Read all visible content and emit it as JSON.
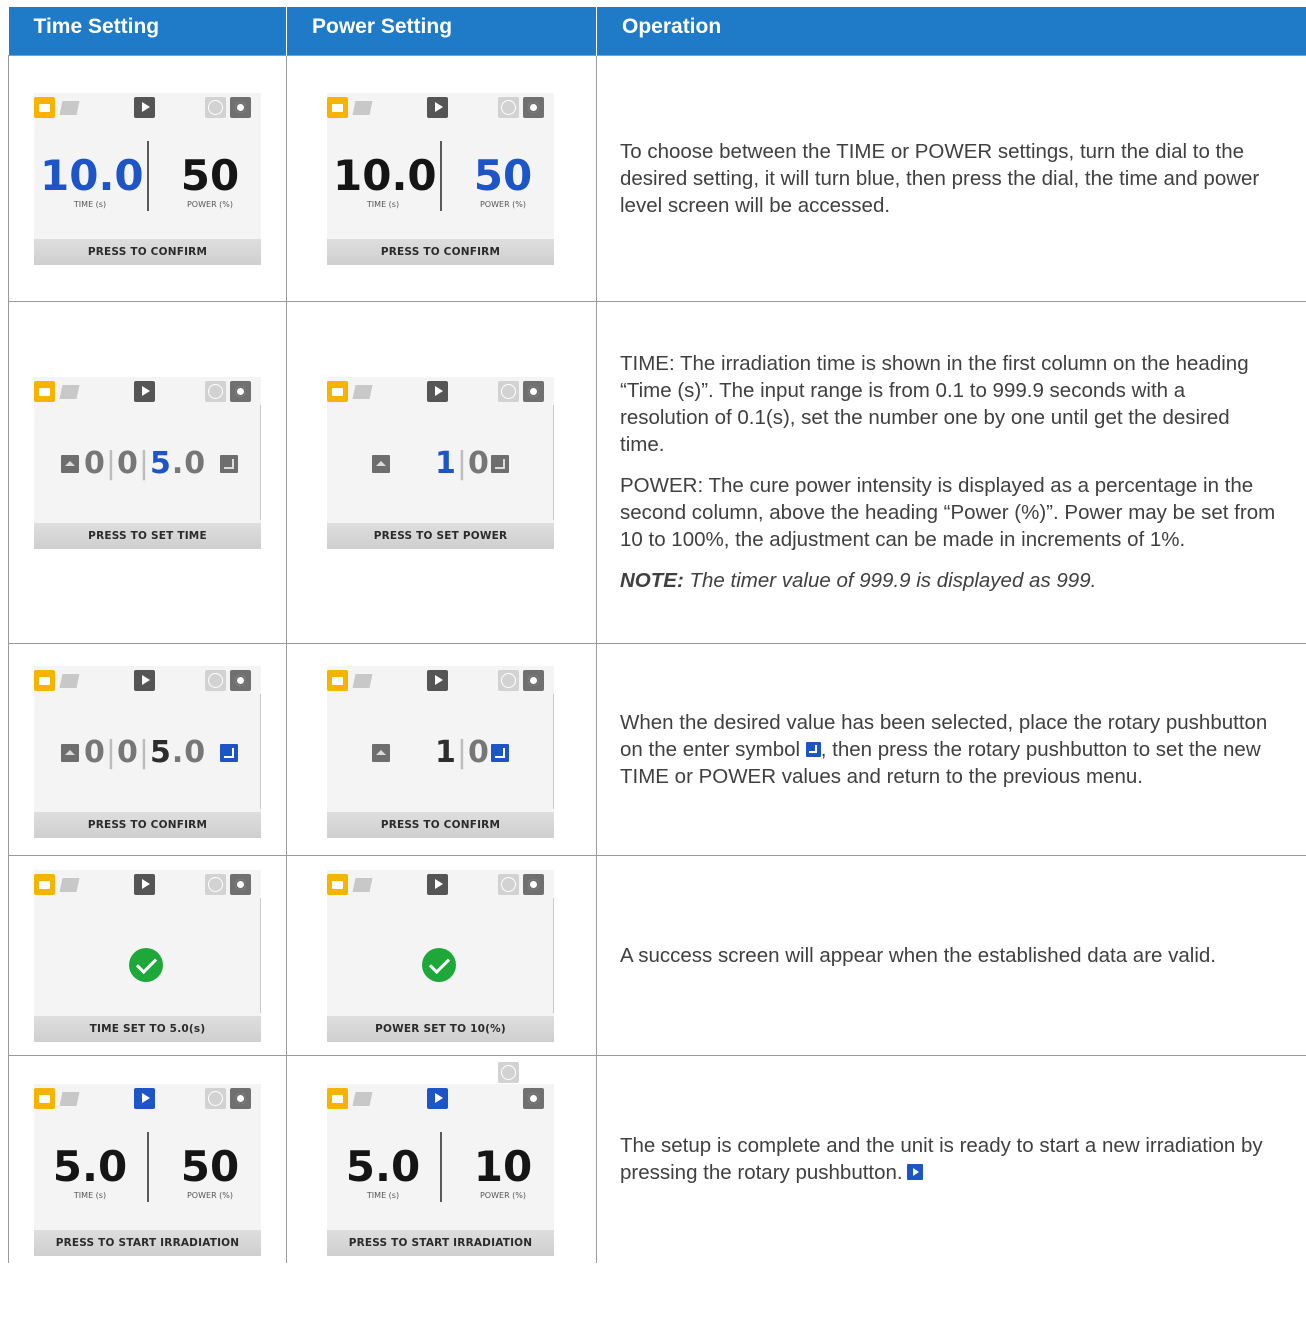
{
  "headers": [
    "Time Setting",
    "Power Setting",
    "Operation"
  ],
  "rows": [
    {
      "time_screen": {
        "time_value": "10.0",
        "power_value": "50",
        "time_label": "TIME (s)",
        "power_label": "POWER (%)",
        "footer": "PRESS TO CONFIRM",
        "selected": "time"
      },
      "power_screen": {
        "time_value": "10.0",
        "power_value": "50",
        "time_label": "TIME (s)",
        "power_label": "POWER (%)",
        "footer": "PRESS TO CONFIRM",
        "selected": "power"
      },
      "operation": [
        "To choose between the TIME or POWER settings, turn the dial to the desired setting, it will turn blue, then press the dial, the time and power level screen will be accessed."
      ]
    },
    {
      "time_screen": {
        "digits": [
          "0",
          "0",
          "5",
          ".0"
        ],
        "footer": "PRESS TO SET TIME"
      },
      "power_screen": {
        "digits": [
          "1",
          "0"
        ],
        "footer": "PRESS TO SET POWER"
      },
      "operation": [
        "TIME:  The irradiation time is shown in the first column on the heading “Time (s)”. The input range is from 0.1 to 999.9 seconds with a resolution of 0.1(s), set the number one by one until get the desired time.",
        "POWER: The cure power intensity is displayed as a percentage in the second column, above the heading “Power (%)”. Power may be set from 10 to 100%, the adjustment can be made in increments of 1%."
      ],
      "note_label": "NOTE:",
      "note_text": " The timer value of 999.9 is displayed as 999."
    },
    {
      "time_screen": {
        "digits": [
          "0",
          "0",
          "5",
          ".0"
        ],
        "footer": "PRESS TO CONFIRM"
      },
      "power_screen": {
        "digits": [
          "1",
          "0"
        ],
        "footer": "PRESS TO CONFIRM"
      },
      "operation_before": "When the desired value has been selected, place the rotary pushbutton on the enter symbol ",
      "operation_after": ", then press the rotary pushbutton to set the new TIME or POWER values and return to the previous menu."
    },
    {
      "time_screen": {
        "footer": "TIME SET TO 5.0(s)"
      },
      "power_screen": {
        "footer": "POWER SET TO 10(%)"
      },
      "operation": [
        "A success screen will appear when the established data are valid."
      ]
    },
    {
      "time_screen": {
        "time_value": "5.0",
        "power_value": "50",
        "time_label": "TIME (s)",
        "power_label": "POWER (%)",
        "footer": "PRESS TO START IRRADIATION"
      },
      "power_screen": {
        "time_value": "5.0",
        "power_value": "10",
        "time_label": "TIME (s)",
        "power_label": "POWER (%)",
        "footer": "PRESS TO START IRRADIATION"
      },
      "operation": [
        "The setup is complete and the unit is ready to start a new irradiation by pressing the rotary pushbutton."
      ]
    }
  ],
  "icons": {
    "folder_open": "folder-open-icon",
    "folder": "folder-icon",
    "play": "play-icon",
    "info": "info-icon",
    "settings": "gear-icon",
    "up": "arrow-up-icon",
    "enter": "enter-icon",
    "success": "check-icon"
  },
  "colors": {
    "header_bg": "#1f7ac7",
    "selected_blue": "#1d55c7",
    "folder_accent": "#f4b400",
    "success_green": "#1fa83a"
  }
}
